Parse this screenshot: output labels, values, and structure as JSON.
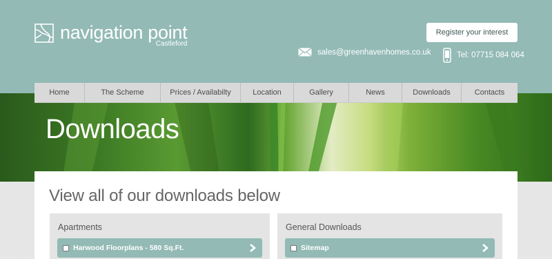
{
  "brand": {
    "name": "navigation point",
    "sub": "Castleford"
  },
  "header": {
    "register_label": "Register your interest",
    "email": "sales@greenhavenhomes.co.uk",
    "phone": "Tel: 07715 084 064"
  },
  "nav": {
    "items": [
      {
        "label": "Home"
      },
      {
        "label": "The Scheme"
      },
      {
        "label": "Prices / Availabilty"
      },
      {
        "label": "Location"
      },
      {
        "label": "Gallery"
      },
      {
        "label": "News"
      },
      {
        "label": "Downloads"
      },
      {
        "label": "Contacts"
      }
    ]
  },
  "hero": {
    "title": "Downloads"
  },
  "main": {
    "title": "View all of our downloads below",
    "sections": [
      {
        "title": "Apartments",
        "items": [
          {
            "label": "Harwood Floorplans - 580 Sq.Ft."
          }
        ]
      },
      {
        "title": "General Downloads",
        "items": [
          {
            "label": "Sitemap"
          }
        ]
      }
    ]
  },
  "colors": {
    "header_bg": "#93bab5",
    "nav_bg": "#d9d9d9",
    "panel_bg": "#e4e4e4",
    "accent": "#93bab5"
  },
  "icons": {
    "logo": "logo-mark-icon",
    "email": "envelope-icon",
    "phone": "mobile-phone-icon",
    "download": "chevron-right-icon"
  }
}
